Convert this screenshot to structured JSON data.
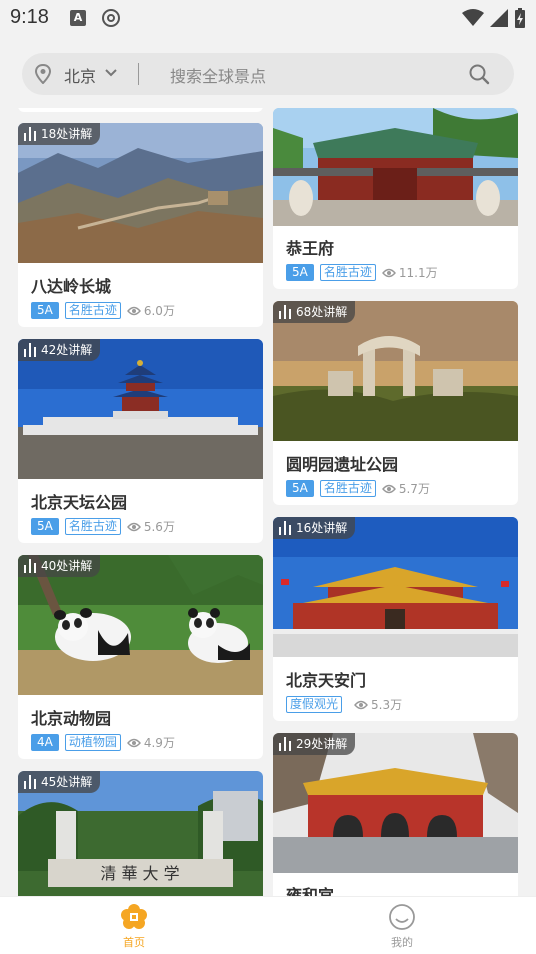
{
  "status": {
    "time": "9:18",
    "a_icon": "A"
  },
  "search": {
    "city": "北京",
    "placeholder": "搜索全球景点"
  },
  "cards": [
    {
      "title": "八达岭长城",
      "badge": "18处讲解",
      "level": "5A",
      "category": "名胜古迹",
      "views": "6.0万"
    },
    {
      "title": "恭王府",
      "badge": "",
      "level": "5A",
      "category": "名胜古迹",
      "views": "11.1万"
    },
    {
      "title": "北京天坛公园",
      "badge": "42处讲解",
      "level": "5A",
      "category": "名胜古迹",
      "views": "5.6万"
    },
    {
      "title": "圆明园遗址公园",
      "badge": "68处讲解",
      "level": "5A",
      "category": "名胜古迹",
      "views": "5.7万"
    },
    {
      "title": "北京动物园",
      "badge": "40处讲解",
      "level": "4A",
      "category": "动植物园",
      "views": "4.9万"
    },
    {
      "title": "北京天安门",
      "badge": "16处讲解",
      "level": "",
      "category": "度假观光",
      "views": "5.3万"
    },
    {
      "title": "",
      "badge": "45处讲解",
      "level": "",
      "category": "",
      "views": ""
    },
    {
      "title": "雍和宫",
      "badge": "29处讲解",
      "level": "",
      "category": "",
      "views": ""
    }
  ],
  "nav": {
    "home_label": "首页",
    "mine_label": "我的"
  },
  "colors": {
    "accent": "#f5a623",
    "tag_blue": "#4a9ee8"
  }
}
